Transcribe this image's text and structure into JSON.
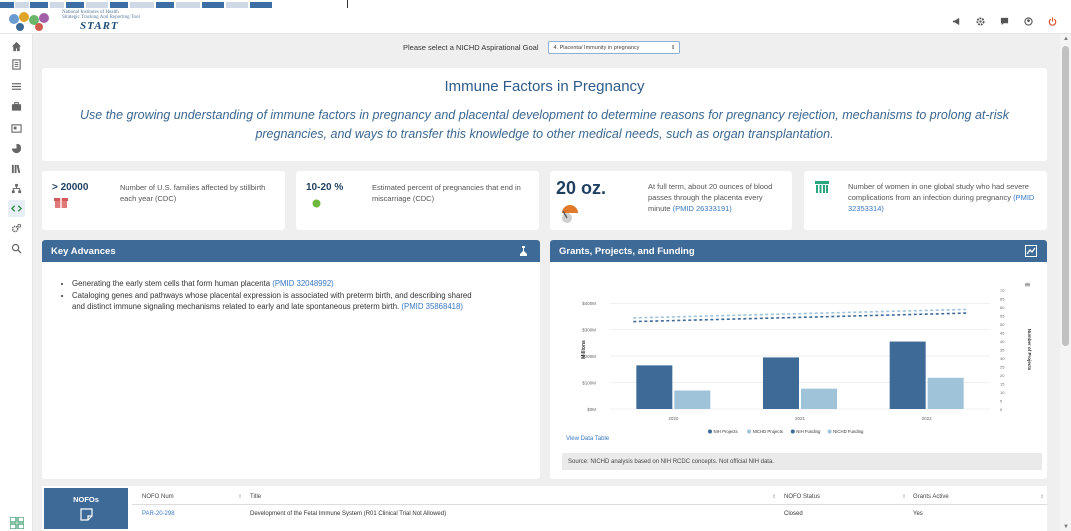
{
  "header": {
    "logo_line1": "National Institutes of Health",
    "logo_line2": "Strategic Tracking And Reporting Tool",
    "logo_word": "START",
    "icons": [
      "megaphone-icon",
      "gear-icon",
      "chat-icon",
      "user-icon",
      "power-icon"
    ]
  },
  "sidebar": {
    "items": [
      "home-icon",
      "document-icon",
      "list-icon",
      "briefcase-icon",
      "newspaper-icon",
      "pie-chart-icon",
      "library-icon",
      "org-chart-icon",
      "code-icon",
      "settings-icon",
      "search-icon"
    ],
    "active_index": 8
  },
  "goal": {
    "label": "Please select a NICHD Aspirational Goal",
    "selected": "4. Placenta/ Immunity in pregnancy"
  },
  "hero": {
    "title": "Immune Factors in Pregnancy",
    "subtitle": "Use the growing understanding of immune factors in pregnancy and placental development to determine reasons for pregnancy rejection, mechanisms to prolong at-risk pregnancies, and ways to transfer this knowledge to other medical needs, such as organ transplantation."
  },
  "stats": [
    {
      "value": "> 20000",
      "text": "Number of U.S. families affected by stillbirth each year (CDC)",
      "icon": "gift-box-icon"
    },
    {
      "value": "10-20 %",
      "text": "Estimated percent of pregnancies that end in miscarriage (CDC)",
      "icon": "green-dot-icon"
    },
    {
      "value": "20 oz.",
      "text_before": "At full term, about 20 ounces of blood passes through the placenta every minute ",
      "pmid": "(PMID 26333191)",
      "icon": "gauge-icon"
    },
    {
      "value": "",
      "text_before": "Number of women in one global study who had severe complications from an infection during pregnancy ",
      "pmid": "(PMID 32353314)",
      "icon": "women-group-icon"
    }
  ],
  "key_advances": {
    "title": "Key Advances",
    "items": [
      {
        "text": "Generating the early stem cells that form human placenta ",
        "pmid": "(PMID 32048992)"
      },
      {
        "text": "Cataloging genes and pathways whose placental expression is associated with preterm birth, and describing shared and distinct immune signaling mechanisms related to early and late spontaneous preterm birth. ",
        "pmid": "(PMID 35868418)"
      }
    ]
  },
  "grants": {
    "title": "Grants, Projects, and Funding",
    "view_table": "View Data Table",
    "source": "Source: NICHD analysis based on NIH RCDC concepts. Not official NIH data."
  },
  "chart_data": {
    "type": "bar",
    "categories": [
      "2020",
      "2021",
      "2022"
    ],
    "ylabel": "Millions",
    "y2label": "Number of Projects",
    "ylim": [
      0,
      450
    ],
    "yticks": [
      "$0M",
      "$100M",
      "$200M",
      "$300M",
      "$400M"
    ],
    "y2lim": [
      0,
      70
    ],
    "y2ticks": [
      "0",
      "5",
      "10",
      "15",
      "20",
      "25",
      "30",
      "35",
      "40",
      "45",
      "50",
      "55",
      "60",
      "65",
      "70"
    ],
    "series": [
      {
        "name": "NIH Funding",
        "values": [
          165,
          195,
          255
        ],
        "color": "#3e6a98"
      },
      {
        "name": "NICHD Funding",
        "values": [
          70,
          77,
          118
        ],
        "color": "#9fc3d9"
      }
    ],
    "line_series": [
      {
        "name": "NIH Projects",
        "values": [
          52,
          55,
          57
        ],
        "color": "#3e6a98"
      },
      {
        "name": "NICHD Projects",
        "values": [
          53,
          56,
          58
        ],
        "color": "#9fc3d9"
      }
    ],
    "legend": [
      "NIH Projects",
      "NICHD Projects",
      "NIH Funding",
      "NICHD Funding"
    ],
    "legend_colors": [
      "#3e6a98",
      "#9fc3d9",
      "#3e6a98",
      "#9fc3d9"
    ]
  },
  "nofo": {
    "label": "NOFOs",
    "headers": [
      "NOFO Num",
      "Title",
      "NOFO Status",
      "Grants Active"
    ],
    "rows": [
      [
        "PAR-20-298",
        "Development of the Fetal Immune System (R01 Clinical Trial Not Allowed)",
        "Closed",
        "Yes"
      ]
    ]
  }
}
